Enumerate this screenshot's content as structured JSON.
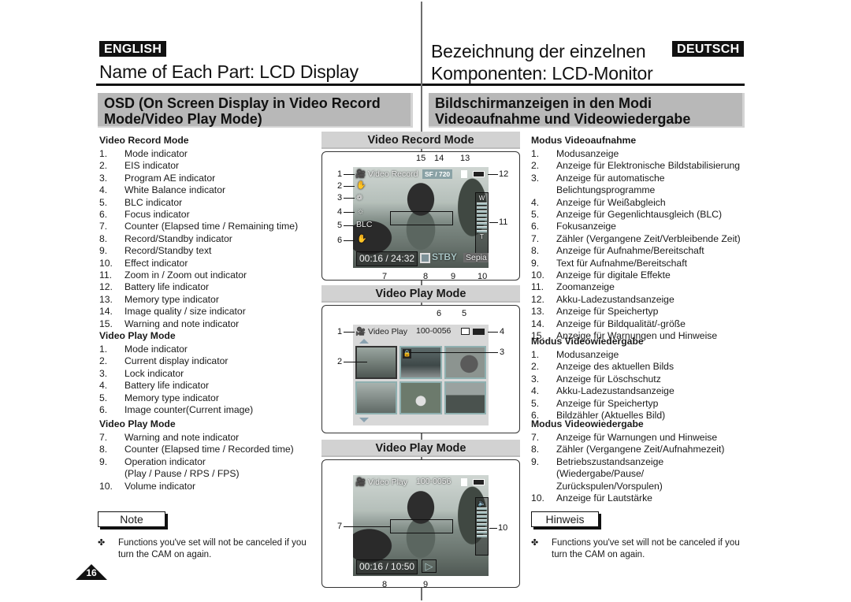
{
  "header": {
    "left_language": "ENGLISH",
    "right_language": "DEUTSCH",
    "left_title": "Name of Each Part: LCD Display",
    "right_title_line1": "Bezeichnung der einzelnen",
    "right_title_line2": "Komponenten: LCD-Monitor"
  },
  "section": {
    "left_line1": "OSD (On Screen Display in Video Record",
    "left_line2": "Mode/Video Play Mode)",
    "right_line1": "Bildschirmanzeigen in den Modi",
    "right_line2": "Videoaufnahme und Videowiedergabe"
  },
  "english": {
    "record_heading": "Video Record Mode",
    "record_items": [
      {
        "num": "1.",
        "text": "Mode indicator"
      },
      {
        "num": "2.",
        "text": "EIS indicator"
      },
      {
        "num": "3.",
        "text": "Program AE indicator"
      },
      {
        "num": "4.",
        "text": "White Balance indicator"
      },
      {
        "num": "5.",
        "text": "BLC indicator"
      },
      {
        "num": "6.",
        "text": "Focus indicator"
      },
      {
        "num": "7.",
        "text": "Counter (Elapsed time / Remaining time)"
      },
      {
        "num": "8.",
        "text": "Record/Standby indicator"
      },
      {
        "num": "9.",
        "text": "Record/Standby text"
      },
      {
        "num": "10.",
        "text": "Effect indicator"
      },
      {
        "num": "11.",
        "text": "Zoom in / Zoom out indicator"
      },
      {
        "num": "12.",
        "text": "Battery life indicator"
      },
      {
        "num": "13.",
        "text": "Memory type indicator"
      },
      {
        "num": "14.",
        "text": "Image quality / size indicator"
      },
      {
        "num": "15.",
        "text": "Warning and note indicator"
      }
    ],
    "play_heading_1": "Video Play Mode",
    "play_items_1": [
      {
        "num": "1.",
        "text": "Mode indicator"
      },
      {
        "num": "2.",
        "text": "Current display indicator"
      },
      {
        "num": "3.",
        "text": "Lock indicator"
      },
      {
        "num": "4.",
        "text": "Battery life indicator"
      },
      {
        "num": "5.",
        "text": "Memory type indicator"
      },
      {
        "num": "6.",
        "text": "Image counter(Current image)"
      }
    ],
    "play_heading_2": "Video Play Mode",
    "play_items_2": [
      {
        "num": "7.",
        "text": "Warning and note indicator"
      },
      {
        "num": "8.",
        "text": "Counter (Elapsed time / Recorded time)"
      },
      {
        "num": "9.",
        "text": "Operation indicator"
      },
      {
        "num": "",
        "text": "(Play / Pause / RPS / FPS)"
      },
      {
        "num": "10.",
        "text": "Volume indicator"
      }
    ],
    "note_label": "Note",
    "note_bullet": "✤",
    "note_text": "Functions you've set will not be canceled if you turn the CAM on again."
  },
  "german": {
    "record_heading": "Modus Videoaufnahme",
    "record_items": [
      {
        "num": "1.",
        "text": "Modusanzeige"
      },
      {
        "num": "2.",
        "text": "Anzeige für Elektronische Bildstabilisierung"
      },
      {
        "num": "3.",
        "text": "Anzeige für automatische"
      },
      {
        "num": "",
        "text": "Belichtungsprogramme"
      },
      {
        "num": "4.",
        "text": "Anzeige für Weißabgleich"
      },
      {
        "num": "5.",
        "text": "Anzeige für Gegenlichtausgleich (BLC)"
      },
      {
        "num": "6.",
        "text": "Fokusanzeige"
      },
      {
        "num": "7.",
        "text": "Zähler (Vergangene Zeit/Verbleibende Zeit)"
      },
      {
        "num": "8.",
        "text": "Anzeige für Aufnahme/Bereitschaft"
      },
      {
        "num": "9.",
        "text": "Text für Aufnahme/Bereitschaft"
      },
      {
        "num": "10.",
        "text": "Anzeige für digitale Effekte"
      },
      {
        "num": "11.",
        "text": "Zoomanzeige"
      },
      {
        "num": "12.",
        "text": "Akku-Ladezustandsanzeige"
      },
      {
        "num": "13.",
        "text": "Anzeige für Speichertyp"
      },
      {
        "num": "14.",
        "text": "Anzeige für Bildqualität/-größe"
      },
      {
        "num": "15.",
        "text": "Anzeige für Warnungen und Hinweise"
      }
    ],
    "play_heading_1": "Modus Videowiedergabe",
    "play_items_1": [
      {
        "num": "1.",
        "text": "Modusanzeige"
      },
      {
        "num": "2.",
        "text": "Anzeige des aktuellen Bilds"
      },
      {
        "num": "3.",
        "text": "Anzeige für Löschschutz"
      },
      {
        "num": "4.",
        "text": "Akku-Ladezustandsanzeige"
      },
      {
        "num": "5.",
        "text": "Anzeige für Speichertyp"
      },
      {
        "num": "6.",
        "text": "Bildzähler (Aktuelles Bild)"
      }
    ],
    "play_heading_2": "Modus Videowiedergabe",
    "play_items_2": [
      {
        "num": "7.",
        "text": "Anzeige für Warnungen und Hinweise"
      },
      {
        "num": "8.",
        "text": "Zähler (Vergangene Zeit/Aufnahmezeit)"
      },
      {
        "num": "9.",
        "text": "Betriebszustandsanzeige"
      },
      {
        "num": "",
        "text": "(Wiedergabe/Pause/"
      },
      {
        "num": "",
        "text": "Zurückspulen/Vorspulen)"
      },
      {
        "num": "10.",
        "text": "Anzeige für Lautstärke"
      }
    ],
    "note_label": "Hinweis",
    "note_bullet": "✤",
    "note_text": "Functions you've set will not be canceled if you turn the CAM on again."
  },
  "figures": {
    "record": {
      "title": "Video Record Mode",
      "mode_icon": "camcorder-icon",
      "mode_text": "Video Record",
      "quality": "SF",
      "size": "720",
      "blc": "BLC",
      "counter": "00:16 / 24:32",
      "status": "STBY",
      "effect": "Sepia",
      "zoom_w": "W",
      "zoom_t": "T",
      "callouts": [
        "1",
        "2",
        "3",
        "4",
        "5",
        "6",
        "7",
        "8",
        "9",
        "10",
        "11",
        "12",
        "13",
        "14",
        "15"
      ]
    },
    "play_thumbs": {
      "title": "Video Play Mode",
      "mode_icon": "camcorder-icon",
      "mode_text": "Video Play",
      "image_counter": "100-0056",
      "callouts": [
        "1",
        "2",
        "3",
        "4",
        "5",
        "6"
      ]
    },
    "play_full": {
      "title": "Video Play Mode",
      "mode_icon": "camcorder-icon",
      "mode_text": "Video Play",
      "image_counter": "100-0056",
      "counter": "00:16 / 10:50",
      "operation": "▷",
      "callouts": [
        "7",
        "8",
        "9",
        "10"
      ]
    }
  },
  "page_number": "16"
}
